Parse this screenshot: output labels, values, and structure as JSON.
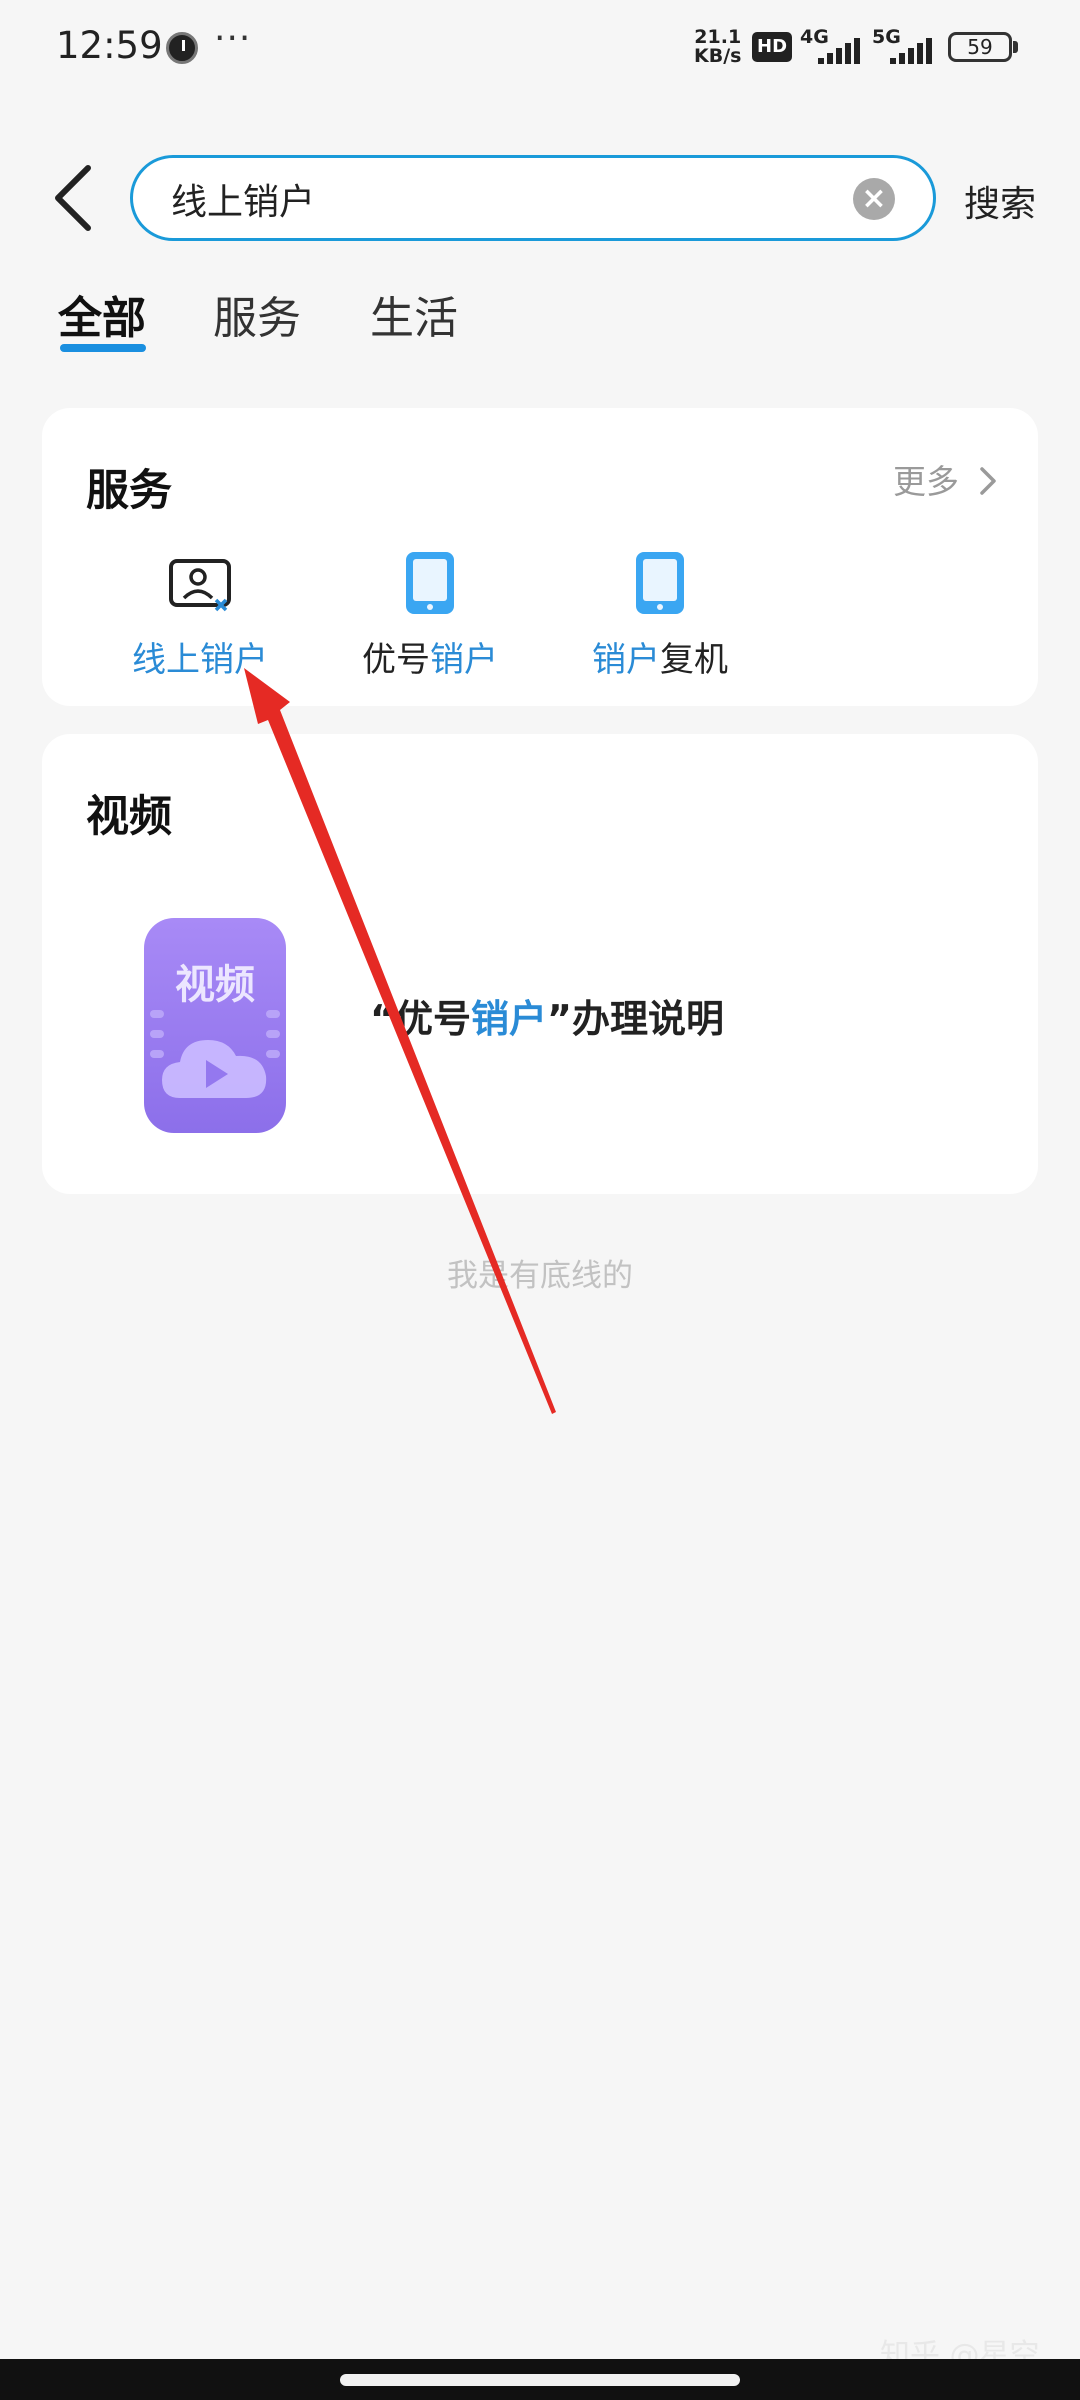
{
  "status_bar": {
    "time": "12:59",
    "more": "···",
    "net_speed_value": "21.1",
    "net_speed_unit": "KB/s",
    "hd": "HD",
    "net1": "4G",
    "net2": "5G",
    "battery": "59"
  },
  "header": {
    "search_value": "线上销户",
    "search_button": "搜索"
  },
  "tabs": [
    {
      "label": "全部",
      "active": true
    },
    {
      "label": "服务",
      "active": false
    },
    {
      "label": "生活",
      "active": false
    }
  ],
  "services_card": {
    "title": "服务",
    "more": "更多",
    "items": [
      {
        "plain_a": "",
        "highlight": "线上销户",
        "plain_b": "",
        "icon": "id-card-icon"
      },
      {
        "plain_a": "优号",
        "highlight": "销户",
        "plain_b": "",
        "icon": "phone-icon"
      },
      {
        "plain_a": "",
        "highlight": "销户",
        "plain_b": "复机",
        "icon": "phone-icon"
      }
    ]
  },
  "video_card": {
    "title": "视频",
    "thumb_text": "视频",
    "item_title": {
      "open_quote": "“",
      "plain_a": "优号",
      "highlight": "销户",
      "close_quote": "”",
      "plain_b": "办理说明"
    }
  },
  "bottom_note": "我是有底线的",
  "watermark": "知乎 @星空",
  "colors": {
    "accent": "#1a9ad9",
    "highlight": "#2a8bd6",
    "annotation_arrow": "#e52a24"
  }
}
